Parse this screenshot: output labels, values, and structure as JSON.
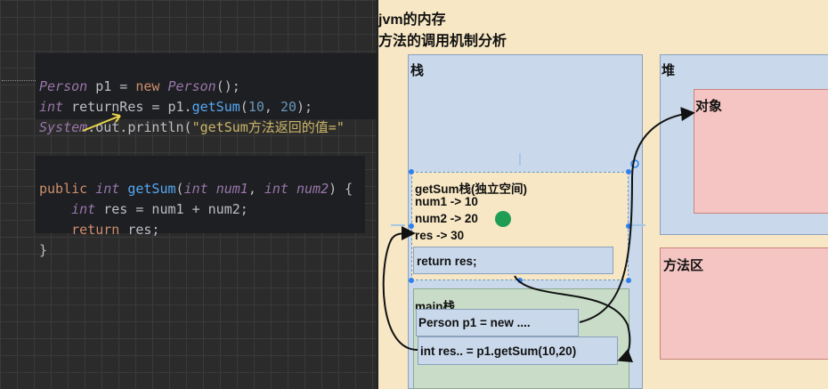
{
  "code1": {
    "line1": {
      "cls": "Person",
      "var": " p1 = ",
      "kw": "new",
      "cls2": "Person",
      "end": "();"
    },
    "line2": {
      "kw": "int",
      "rest": " returnRes = p1.",
      "fn": "getSum",
      "open": "(",
      "n1": "10",
      "sep": ", ",
      "n2": "20",
      "close": ");"
    },
    "line3": {
      "cls": "System",
      "dot": ".out.println(",
      "str": "\"getSum方法返回的值=\""
    }
  },
  "code2": {
    "line1": {
      "kw": "public",
      "kw2": "int",
      "fn": "getSum",
      "open": "(",
      "kw3": "int",
      "p1": "num1",
      "sep": ", ",
      "kw4": "int",
      "p2": "num2",
      "close": ") {"
    },
    "line2": {
      "kw": "int",
      "rest": " res = num1 + num2;"
    },
    "line3": {
      "kw": "return",
      "rest": " res;"
    },
    "line4": "}"
  },
  "diagram": {
    "title1": "jvm的内存",
    "title2": "方法的调用机制分析",
    "stack_label": "栈",
    "heap_label": "堆",
    "object_label": "对象",
    "method_area_label": "方法区",
    "frame_getsum": {
      "title": "getSum栈(独立空间)",
      "lines": [
        "num1 -> 10",
        "num2 -> 20",
        "res -> 30"
      ],
      "return_stmt": "return res;"
    },
    "frame_main": {
      "title": "main栈",
      "line1": "Person p1 = new ....",
      "line2": "int res.. = p1.getSum(10,20)"
    }
  },
  "colors": {
    "stack": "#c9d8ea",
    "heap_object": "#f4c5c2",
    "background": "#f7e7c4",
    "main_frame": "#c8dcc8"
  }
}
